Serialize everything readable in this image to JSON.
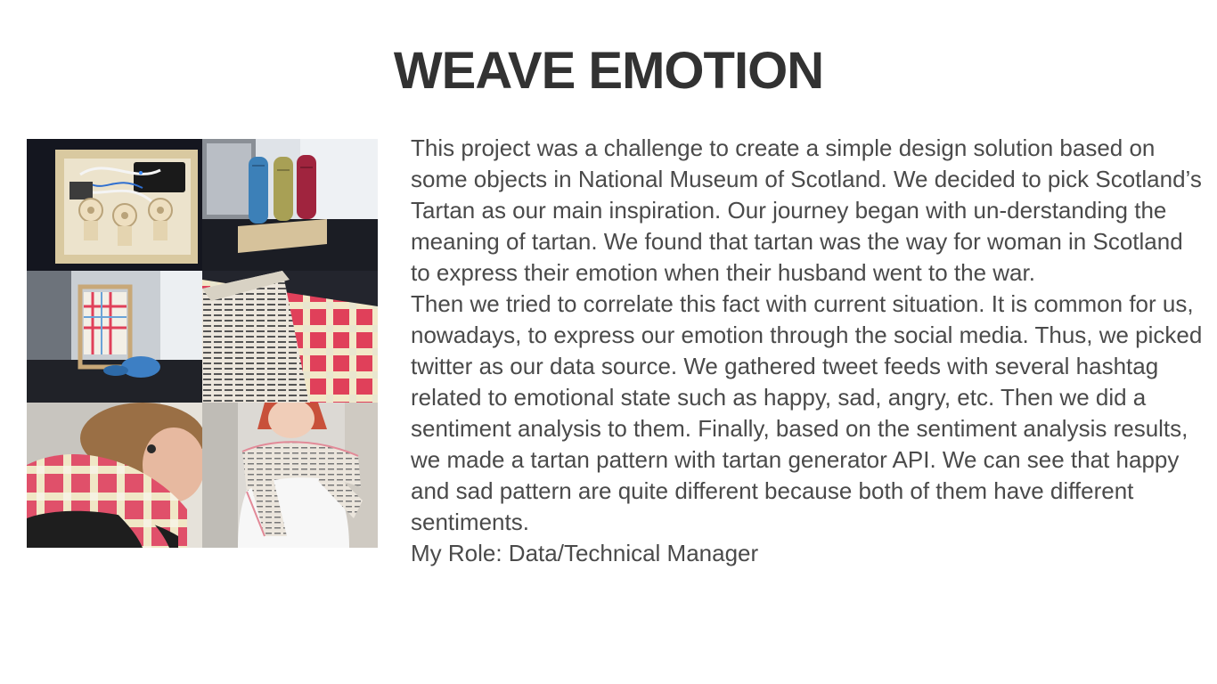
{
  "slide": {
    "title": "WEAVE EMOTION",
    "paragraphs": [
      "This project was a challenge to create a simple design solution based on some objects in National Museum of Scotland. We decided to pick Scotland’s Tartan as our main inspiration. Our journey began with un-derstanding the meaning of tartan. We found that tartan was the way for woman in Scotland to express their emotion when their husband went to the war.",
      "Then we tried to correlate this fact with current situation. It is common for us, nowadays, to express our emotion through the social media. Thus, we picked twitter as our data source. We gathered tweet feeds with several hashtag related to emotional state such as happy, sad, angry, etc. Then we did a sentiment analysis to them. Finally, based on the sentiment analysis results, we made a tartan pattern with tartan generator API. We can see that happy and sad pattern are quite different because both of them have different sentiments.",
      "My Role: Data/Technical Manager"
    ]
  },
  "colors": {
    "title": "#323232",
    "body_text": "#4a4a4a",
    "tartan_red": "#e0405a",
    "tartan_cream": "#f2e8c8",
    "dark_background": "#1c1c22"
  }
}
